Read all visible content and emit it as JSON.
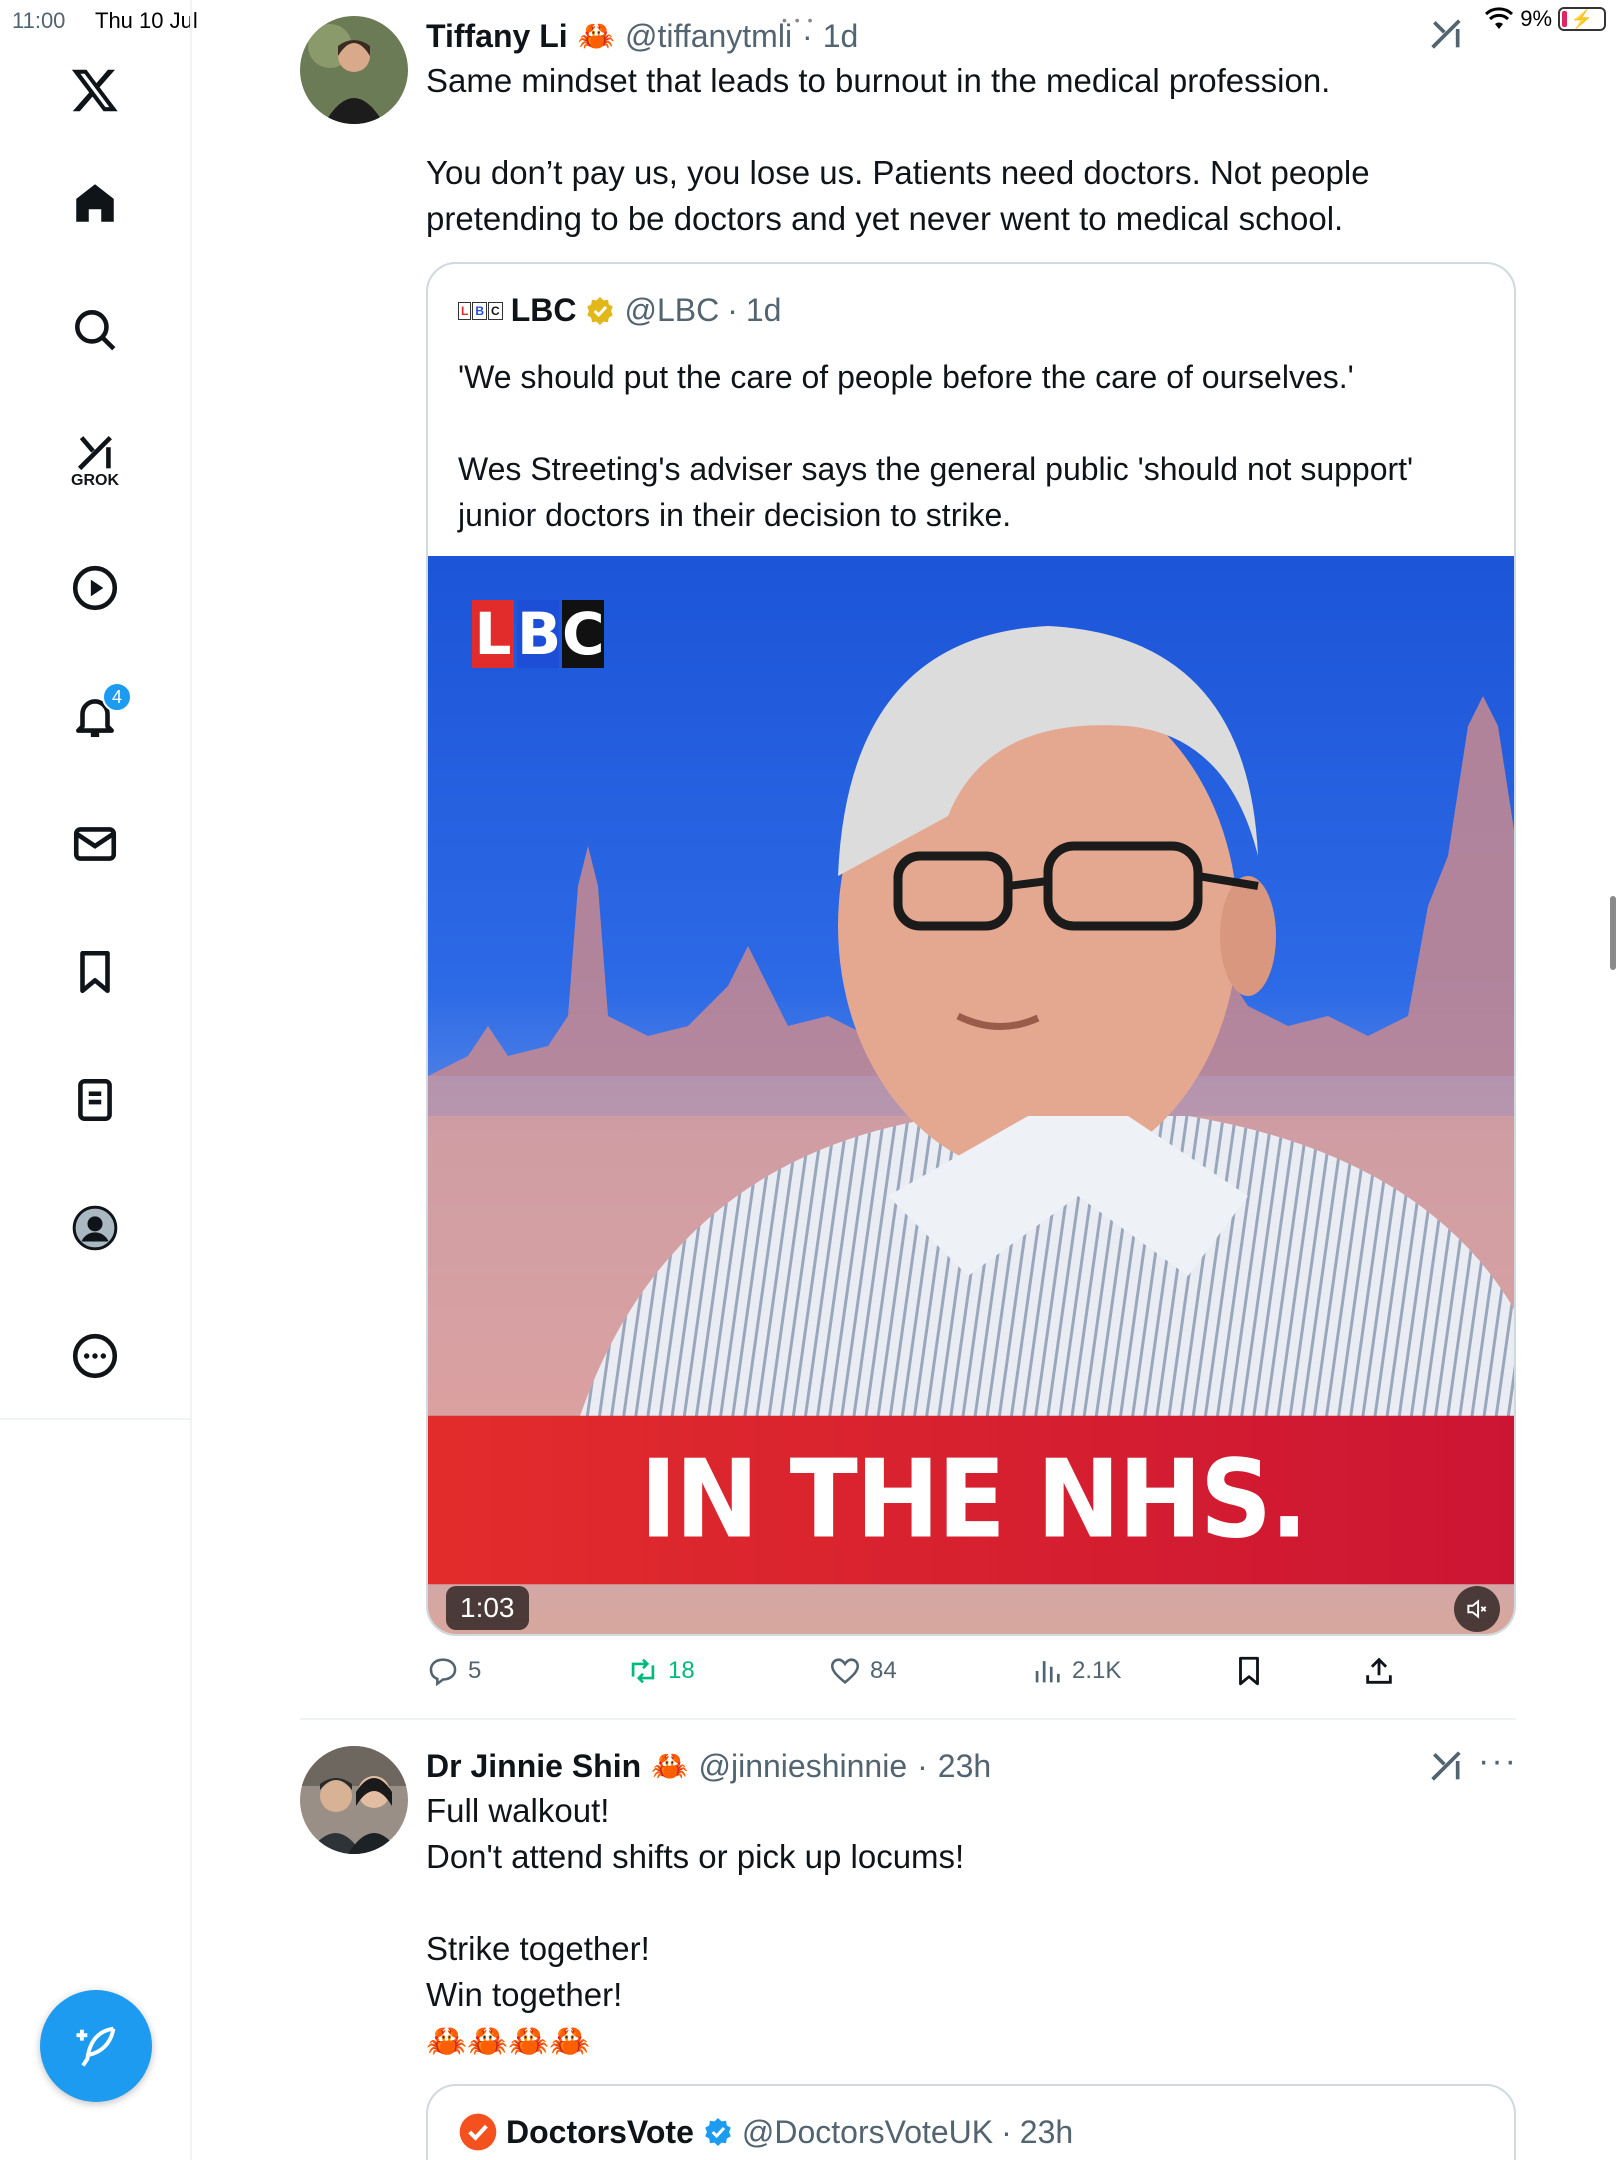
{
  "status_bar": {
    "time": "11:00",
    "date": "Thu 10 Jul",
    "battery": "9%"
  },
  "sidebar": {
    "grok_label": "GROK",
    "notification_count": "4"
  },
  "tweet1": {
    "name": "Tiffany Li",
    "emoji": "🦀",
    "handle": "@tiffanytmli",
    "dot": "·",
    "time": "1d",
    "lines": [
      "Same mindset that leads to burnout in the medical profession.",
      "",
      "You don’t pay us, you lose us. Patients need doctors. Not people pretending to be doctors and yet never went to medical school."
    ],
    "quote": {
      "name": "LBC",
      "handle": "@LBC",
      "dot": "·",
      "time": "1d",
      "lines": [
        "'We should put the care of people before the care of ourselves.'",
        "",
        "Wes Streeting's adviser says the general public 'should not support' junior doctors in their decision to strike."
      ],
      "media": {
        "logo_letters": [
          "L",
          "B",
          "C"
        ],
        "banner": "IN THE NHS.",
        "duration": "1:03"
      }
    },
    "actions": {
      "replies": "5",
      "retweets": "18",
      "likes": "84",
      "views": "2.1K"
    },
    "colors": {
      "retweet": "#00ba7c",
      "accent": "#1d9bf0"
    }
  },
  "tweet2": {
    "name": "Dr Jinnie Shin",
    "emoji": "🦀",
    "handle": "@jinnieshinnie",
    "dot": "·",
    "time": "23h",
    "lines": [
      "Full walkout!",
      "Don't attend shifts or pick up locums!",
      "",
      "Strike together!",
      "Win together!",
      "🦀🦀🦀🦀"
    ],
    "quote": {
      "name": "DoctorsVote",
      "handle": "@DoctorsVoteUK",
      "dot": "·",
      "time": "23h"
    }
  }
}
